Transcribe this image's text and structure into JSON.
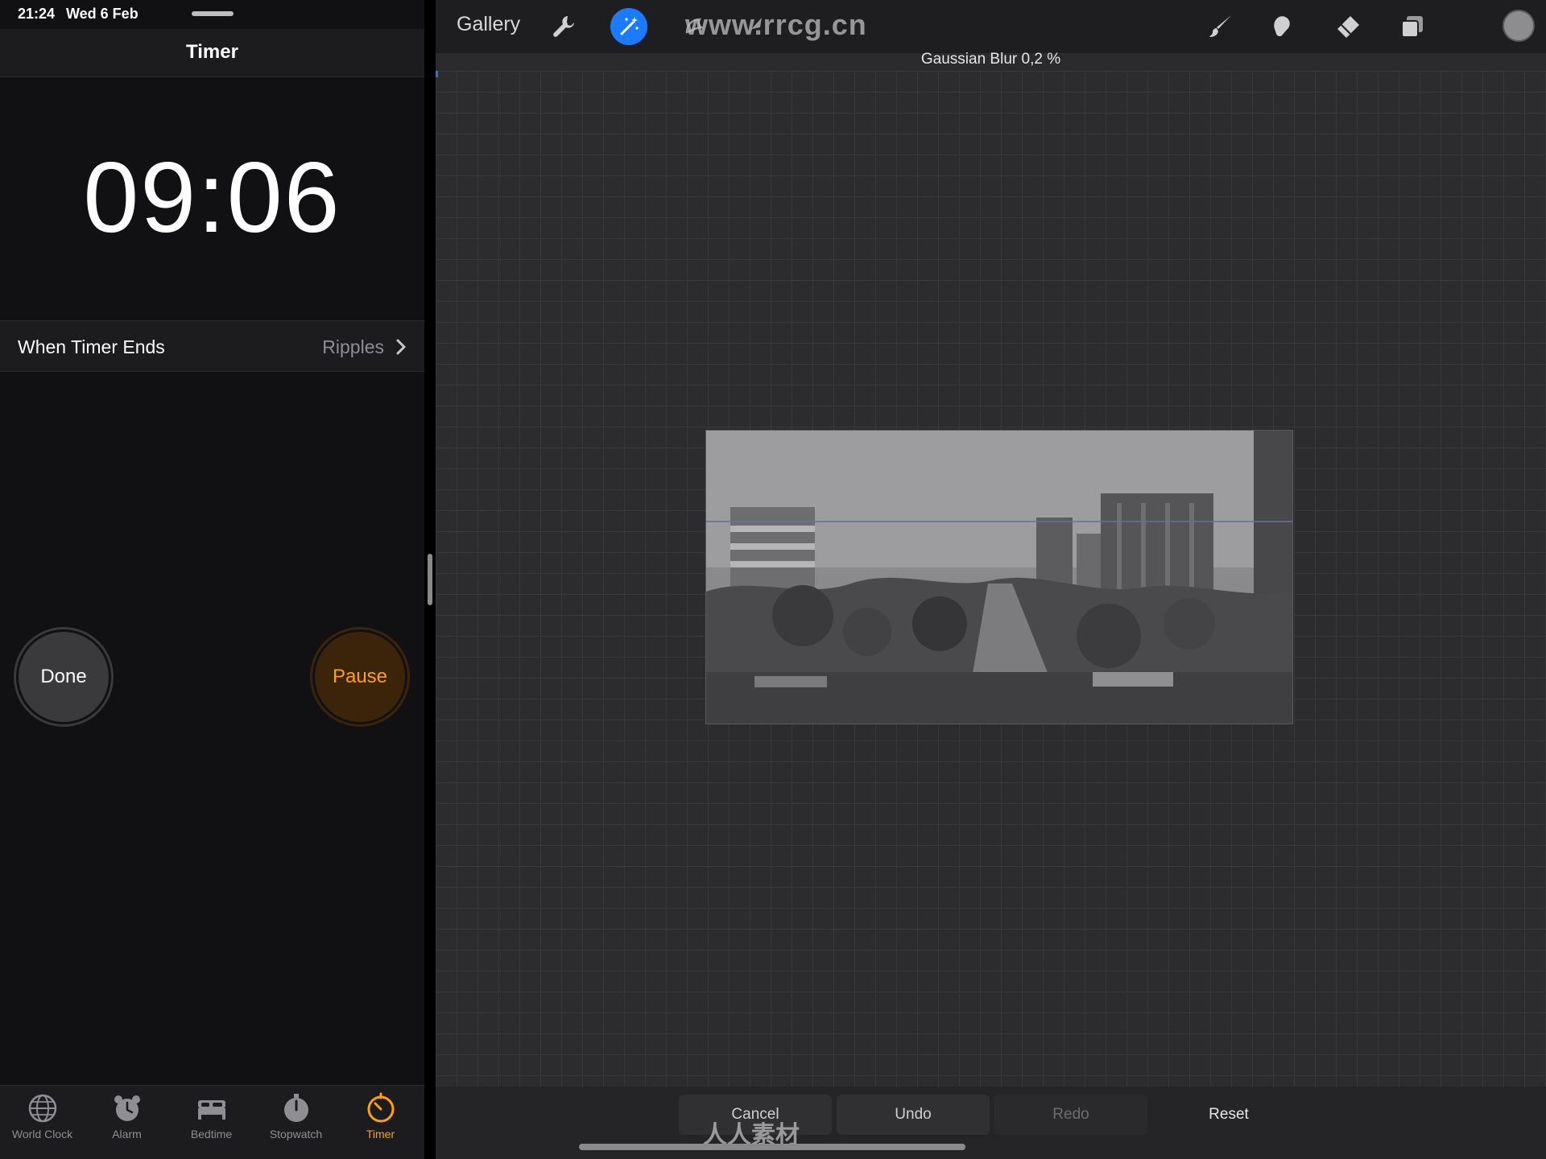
{
  "status_bar": {
    "time": "21:24",
    "date": "Wed 6 Feb"
  },
  "timer": {
    "title": "Timer",
    "countdown": "09:06",
    "when_ends_label": "When Timer Ends",
    "when_ends_value": "Ripples",
    "done_label": "Done",
    "pause_label": "Pause",
    "accent_color": "#ff9f0a"
  },
  "tabs": [
    {
      "label": "World Clock",
      "icon": "globe-icon"
    },
    {
      "label": "Alarm",
      "icon": "alarm-clock-icon"
    },
    {
      "label": "Bedtime",
      "icon": "bed-icon"
    },
    {
      "label": "Stopwatch",
      "icon": "stopwatch-icon"
    },
    {
      "label": "Timer",
      "icon": "timer-icon",
      "active": true
    }
  ],
  "procreate": {
    "gallery_label": "Gallery",
    "adjustment_label": "Gaussian Blur 0,2 %",
    "watermark_url": "www.rrcg.cn",
    "tools": [
      "wrench-icon",
      "magic-wand-icon",
      "selection-icon",
      "transform-arrow-icon",
      "brush-icon",
      "smudge-icon",
      "eraser-icon",
      "layers-icon"
    ],
    "accent_color": "#1a7bff",
    "bottom": {
      "cancel": "Cancel",
      "undo": "Undo",
      "redo": "Redo",
      "reset": "Reset"
    },
    "bottom_watermark": "人人素材"
  }
}
